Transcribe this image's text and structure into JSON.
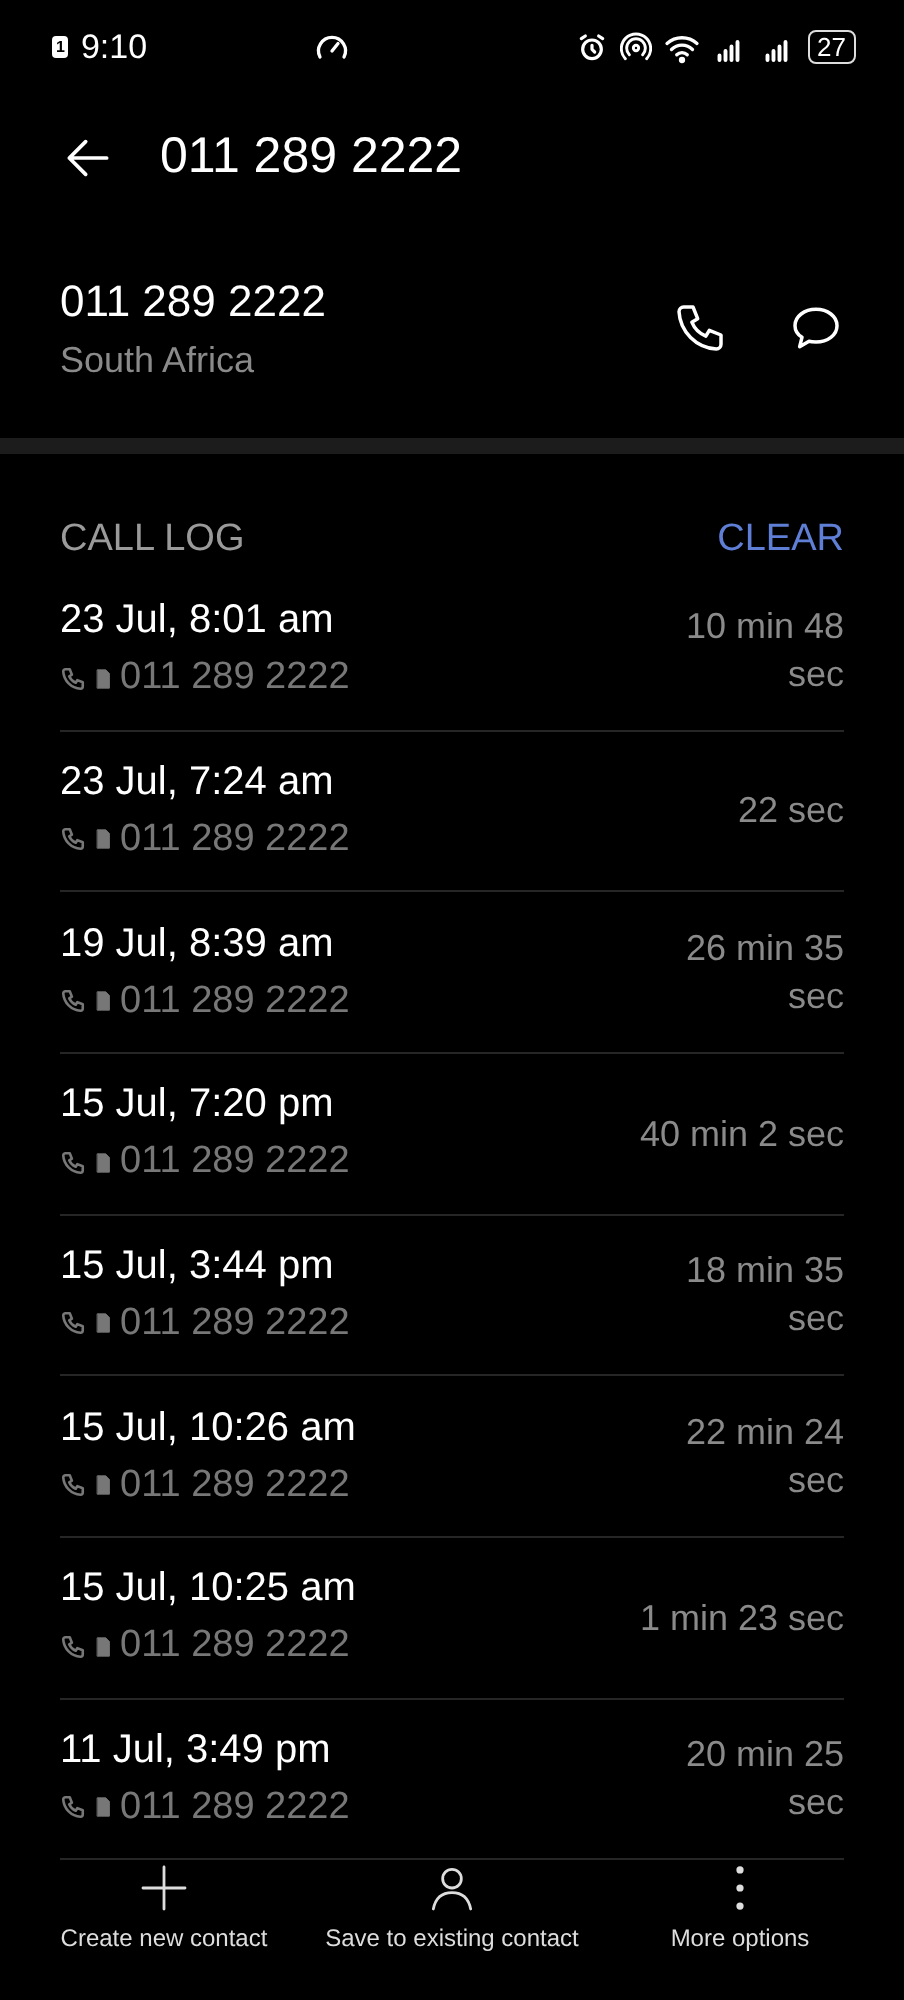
{
  "status_bar": {
    "time": "9:10",
    "sim_badge": "1",
    "battery": "27"
  },
  "header": {
    "title": "011 289 2222"
  },
  "contact": {
    "number": "011 289 2222",
    "location": "South Africa"
  },
  "call_log": {
    "title": "CALL LOG",
    "clear": "CLEAR",
    "rows": [
      {
        "date": "23 Jul, 8:01 am",
        "number": "011 289 2222",
        "duration": "10 min 48 sec"
      },
      {
        "date": "23 Jul, 7:24 am",
        "number": "011 289 2222",
        "duration": "22 sec"
      },
      {
        "date": "19 Jul, 8:39 am",
        "number": "011 289 2222",
        "duration": "26 min 35 sec"
      },
      {
        "date": "15 Jul, 7:20 pm",
        "number": "011 289 2222",
        "duration": "40 min 2 sec"
      },
      {
        "date": "15 Jul, 3:44 pm",
        "number": "011 289 2222",
        "duration": "18 min 35 sec"
      },
      {
        "date": "15 Jul, 10:26 am",
        "number": "011 289 2222",
        "duration": "22 min 24 sec"
      },
      {
        "date": "15 Jul, 10:25 am",
        "number": "011 289 2222",
        "duration": "1 min 23 sec"
      },
      {
        "date": "11 Jul, 3:49 pm",
        "number": "011 289 2222",
        "duration": "20 min 25 sec"
      }
    ]
  },
  "bottom_actions": [
    {
      "kind": "add",
      "label": "Create new contact"
    },
    {
      "kind": "person",
      "label": "Save to existing contact"
    },
    {
      "kind": "more",
      "label": "More options"
    }
  ]
}
